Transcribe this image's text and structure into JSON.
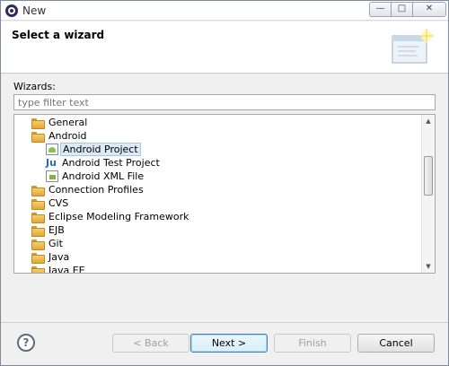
{
  "window": {
    "title": "New"
  },
  "titlebar": {
    "minimize": "—",
    "maximize": "□",
    "close": "✕"
  },
  "banner": {
    "title": "Select a wizard",
    "icon": "wizard-banner-icon"
  },
  "wizards_label": "Wizards:",
  "filter": {
    "placeholder": "type filter text",
    "value": ""
  },
  "tree": {
    "items": [
      {
        "label": "General",
        "icon": "folder-icon",
        "level": 1
      },
      {
        "label": "Android",
        "icon": "folder-icon",
        "level": 1
      },
      {
        "label": "Android Project",
        "icon": "android-project-icon",
        "level": 2,
        "selected": true
      },
      {
        "label": "Android Test Project",
        "icon": "android-test-icon",
        "level": 2
      },
      {
        "label": "Android XML File",
        "icon": "android-xml-icon",
        "level": 2
      },
      {
        "label": "Connection Profiles",
        "icon": "folder-icon",
        "level": 1
      },
      {
        "label": "CVS",
        "icon": "folder-icon",
        "level": 1
      },
      {
        "label": "Eclipse Modeling Framework",
        "icon": "folder-icon",
        "level": 1
      },
      {
        "label": "EJB",
        "icon": "folder-icon",
        "level": 1
      },
      {
        "label": "Git",
        "icon": "folder-icon",
        "level": 1
      },
      {
        "label": "Java",
        "icon": "folder-icon",
        "level": 1
      },
      {
        "label": "Java EE",
        "icon": "folder-icon",
        "level": 1
      }
    ]
  },
  "buttons": {
    "help": "?",
    "back": "< Back",
    "next": "Next >",
    "finish": "Finish",
    "cancel": "Cancel"
  },
  "colors": {
    "selection": "#dce9f7",
    "default_button": "#3c7fb1"
  }
}
